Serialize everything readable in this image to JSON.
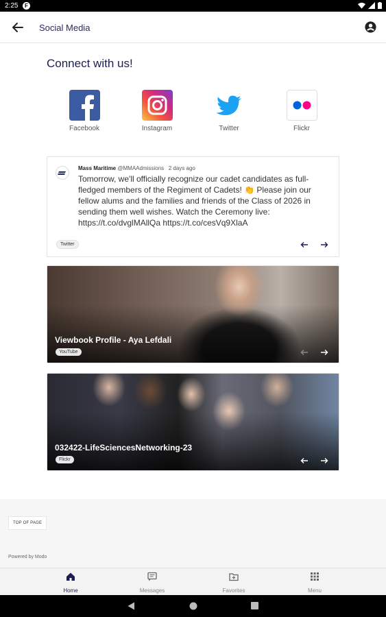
{
  "status_bar": {
    "time": "2:25",
    "notif_letter": "F"
  },
  "app_bar": {
    "title": "Social Media"
  },
  "heading": "Connect with us!",
  "socials": [
    {
      "label": "Facebook",
      "icon": "facebook-icon"
    },
    {
      "label": "Instagram",
      "icon": "instagram-icon"
    },
    {
      "label": "Twitter",
      "icon": "twitter-icon"
    },
    {
      "label": "Flickr",
      "icon": "flickr-icon"
    }
  ],
  "tweet": {
    "author_name": "Mass Maritime",
    "author_handle": "@MMAAdmissions",
    "time_ago": "2 days ago",
    "text": "Tomorrow, we'll officially recognize our cadet candidates as full-fledged members of the Regiment of Cadets! 👏 Please join our fellow alums and the families and friends of the Class of 2026 in sending them well wishes. Watch the Ceremony live: https://t.co/dvglMAllQa https://t.co/cesVq9XlaA",
    "source": "Twitter"
  },
  "media_cards": [
    {
      "title": "Viewbook Profile - Aya Lefdali",
      "source": "YouTube"
    },
    {
      "title": "032422-LifeSciencesNetworking-23",
      "source": "Flickr"
    }
  ],
  "footer": {
    "top_of_page": "TOP OF PAGE",
    "powered_by": "Powered by Modo"
  },
  "tabs": [
    {
      "label": "Home",
      "icon": "home-icon",
      "active": true
    },
    {
      "label": "Messages",
      "icon": "messages-icon",
      "active": false
    },
    {
      "label": "Favorites",
      "icon": "favorites-icon",
      "active": false
    },
    {
      "label": "Menu",
      "icon": "grid-menu-icon",
      "active": false
    }
  ],
  "colors": {
    "accent": "#1c1c54",
    "facebook": "#3b5ba2",
    "twitter": "#1da1f2"
  }
}
